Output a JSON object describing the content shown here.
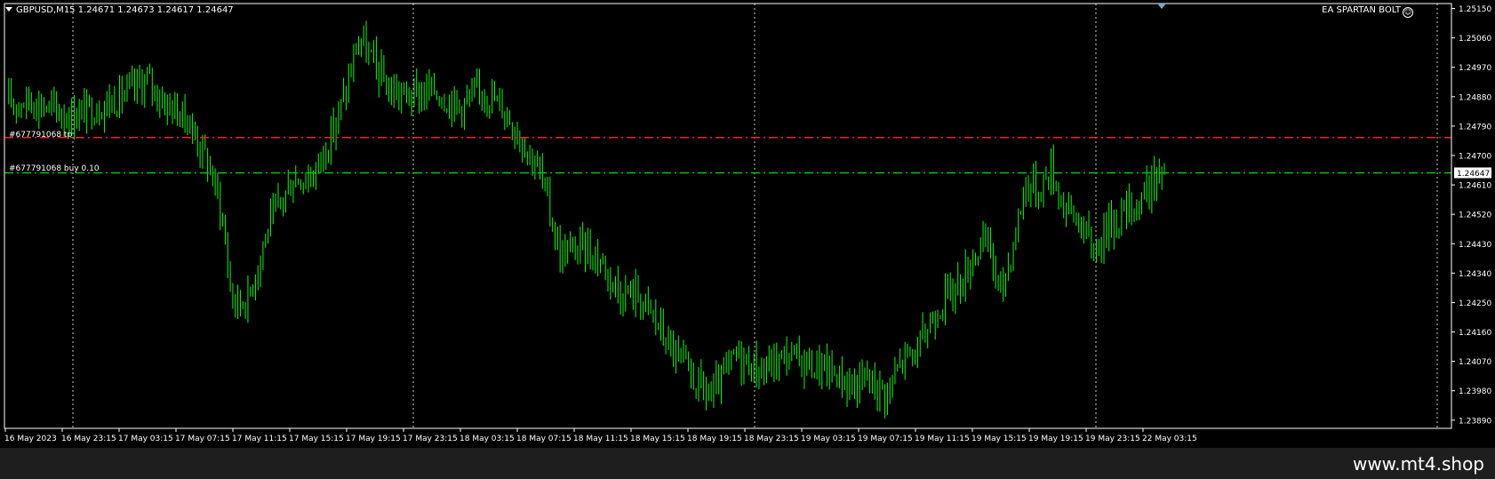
{
  "chart_header": {
    "symbol_line": "GBPUSD,M15  1.24671 1.24673 1.24617 1.24647",
    "expert_advisor": "EA SPARTAN BOLT",
    "expert_icon": "smiley-face-icon"
  },
  "orders": {
    "tp_label": "#677791068 tp",
    "tp_price": 1.24755,
    "tp_color": "#ff1e1e",
    "entry_label": "#677791068 buy 0.10",
    "entry_price": 1.24647,
    "entry_color": "#00c800"
  },
  "current_price_label": "1.24647",
  "candle_color": "#00ff00",
  "price_axis_labels": [
    "1.25150",
    "1.25060",
    "1.24970",
    "1.24880",
    "1.24790",
    "1.24700",
    "1.24610",
    "1.24520",
    "1.24430",
    "1.24340",
    "1.24250",
    "1.24160",
    "1.24070",
    "1.23980",
    "1.23890"
  ],
  "time_axis_labels": [
    "16 May 2023",
    "16 May 23:15",
    "17 May 03:15",
    "17 May 07:15",
    "17 May 11:15",
    "17 May 15:15",
    "17 May 19:15",
    "17 May 23:15",
    "18 May 03:15",
    "18 May 07:15",
    "18 May 11:15",
    "18 May 15:15",
    "18 May 19:15",
    "18 May 23:15",
    "19 May 03:15",
    "19 May 07:15",
    "19 May 11:15",
    "19 May 15:15",
    "19 May 19:15",
    "19 May 23:15",
    "22 May 03:15"
  ],
  "footer": {
    "watermark": "www.mt4.shop"
  },
  "chart_data": {
    "type": "candlestick",
    "symbol": "GBPUSD",
    "timeframe": "M15",
    "ylim": [
      1.23865,
      1.25165
    ],
    "grid": true,
    "close_path": [
      [
        0,
        1.2486
      ],
      [
        10,
        1.2487
      ],
      [
        25,
        1.2482
      ],
      [
        40,
        1.2486
      ],
      [
        48,
        1.2489
      ],
      [
        56,
        1.2493
      ],
      [
        62,
        1.2487
      ],
      [
        72,
        1.2481
      ],
      [
        80,
        1.2468
      ],
      [
        85,
        1.2455
      ],
      [
        90,
        1.2425
      ],
      [
        96,
        1.2426
      ],
      [
        104,
        1.2448
      ],
      [
        114,
        1.2463
      ],
      [
        122,
        1.2464
      ],
      [
        130,
        1.2478
      ],
      [
        135,
        1.249
      ],
      [
        140,
        1.2506
      ],
      [
        146,
        1.2498
      ],
      [
        152,
        1.249
      ],
      [
        160,
        1.2488
      ],
      [
        170,
        1.249
      ],
      [
        180,
        1.2485
      ],
      [
        190,
        1.249
      ],
      [
        198,
        1.2484
      ],
      [
        205,
        1.2475
      ],
      [
        212,
        1.2465
      ],
      [
        220,
        1.244
      ],
      [
        230,
        1.2442
      ],
      [
        236,
        1.2438
      ],
      [
        244,
        1.2428
      ],
      [
        250,
        1.2428
      ],
      [
        256,
        1.2422
      ],
      [
        264,
        1.2411
      ],
      [
        272,
        1.2402
      ],
      [
        280,
        1.2396
      ],
      [
        290,
        1.2409
      ],
      [
        300,
        1.2404
      ],
      [
        310,
        1.2409
      ],
      [
        320,
        1.2406
      ],
      [
        330,
        1.2403
      ],
      [
        336,
        1.2399
      ],
      [
        342,
        1.2402
      ],
      [
        350,
        1.2397
      ],
      [
        356,
        1.2408
      ],
      [
        362,
        1.241
      ],
      [
        370,
        1.2424
      ],
      [
        380,
        1.2432
      ],
      [
        385,
        1.2441
      ],
      [
        390,
        1.2443
      ],
      [
        395,
        1.2428
      ],
      [
        400,
        1.2443
      ],
      [
        405,
        1.2462
      ],
      [
        410,
        1.2459
      ],
      [
        415,
        1.2466
      ],
      [
        420,
        1.2455
      ],
      [
        426,
        1.245
      ],
      [
        432,
        1.2441
      ],
      [
        438,
        1.2449
      ],
      [
        443,
        1.2452
      ],
      [
        450,
        1.2456
      ],
      [
        455,
        1.2462
      ],
      [
        460,
        1.2464
      ]
    ]
  }
}
